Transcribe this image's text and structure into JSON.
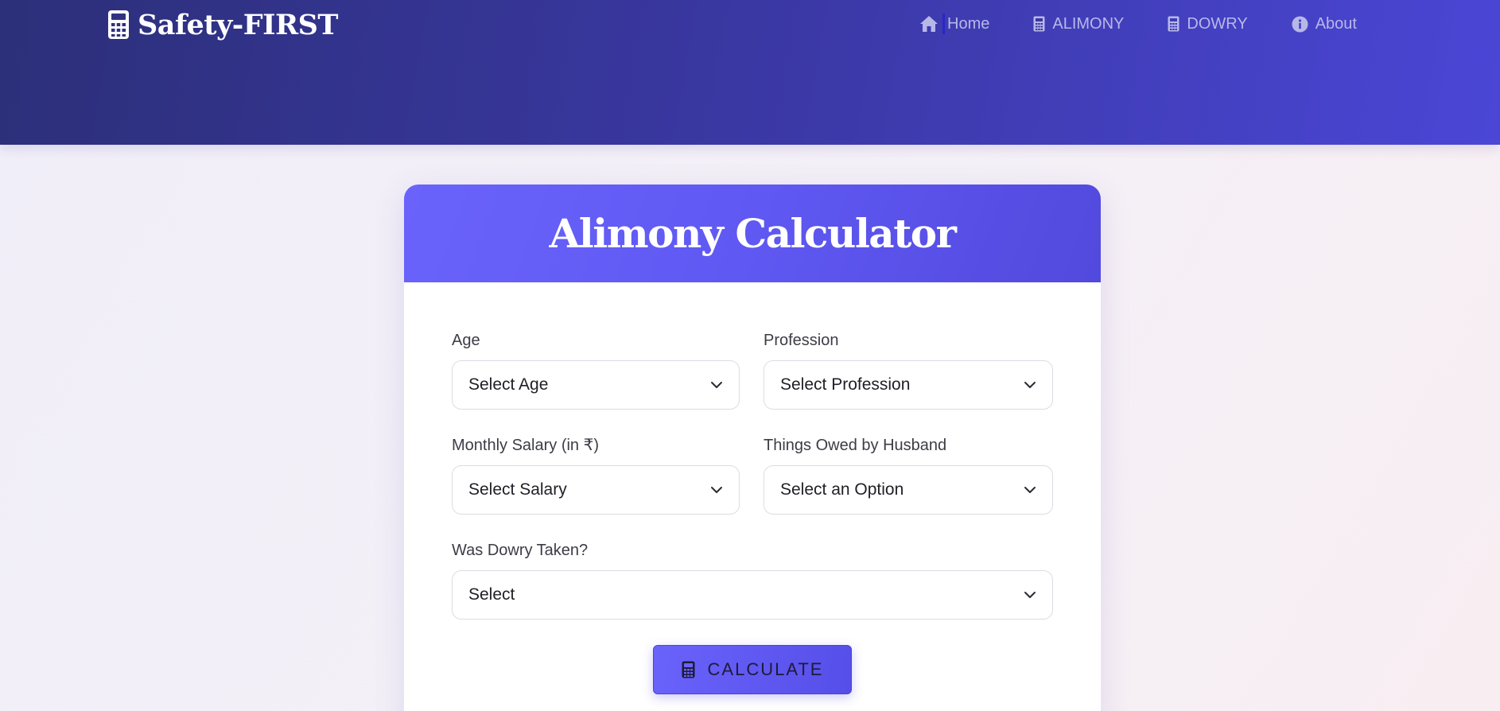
{
  "header": {
    "brand": "Safety-FIRST",
    "nav": [
      {
        "label": "Home",
        "icon": "home-icon"
      },
      {
        "label": "ALIMONY",
        "icon": "calculator-icon"
      },
      {
        "label": "DOWRY",
        "icon": "calculator-icon"
      },
      {
        "label": "About",
        "icon": "info-icon"
      }
    ]
  },
  "card": {
    "title": "Alimony Calculator",
    "fields": {
      "age": {
        "label": "Age",
        "value": "Select Age"
      },
      "profession": {
        "label": "Profession",
        "value": "Select Profession"
      },
      "salary": {
        "label": "Monthly Salary (in ₹)",
        "value": "Select Salary"
      },
      "owed": {
        "label": "Things Owed by Husband",
        "value": "Select an Option"
      },
      "dowry": {
        "label": "Was Dowry Taken?",
        "value": "Select"
      }
    },
    "button_label": "CALCULATE"
  },
  "colors": {
    "header_start": "#2c2f79",
    "header_end": "#4b46d6",
    "accent": "#6a63fb",
    "nav_text": "#b8b8e8"
  }
}
